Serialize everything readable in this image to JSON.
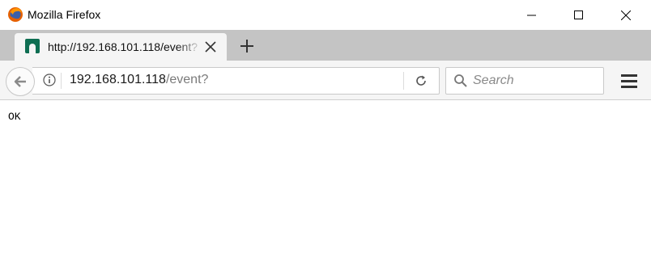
{
  "window": {
    "title": "Mozilla Firefox",
    "controls": [
      "minimize-icon",
      "maximize-icon",
      "close-icon"
    ]
  },
  "tab": {
    "title": "http://192.168.101.118/event?",
    "favicon": "n-logo-icon",
    "favicon_color": "#0e6e52"
  },
  "navbar": {
    "url_host": "192.168.101.118",
    "url_path": "/event?",
    "search_placeholder": "Search"
  },
  "page": {
    "body_text": "OK"
  },
  "colors": {
    "tabstrip": "#c4c4c4",
    "toolbar": "#f5f5f5"
  }
}
